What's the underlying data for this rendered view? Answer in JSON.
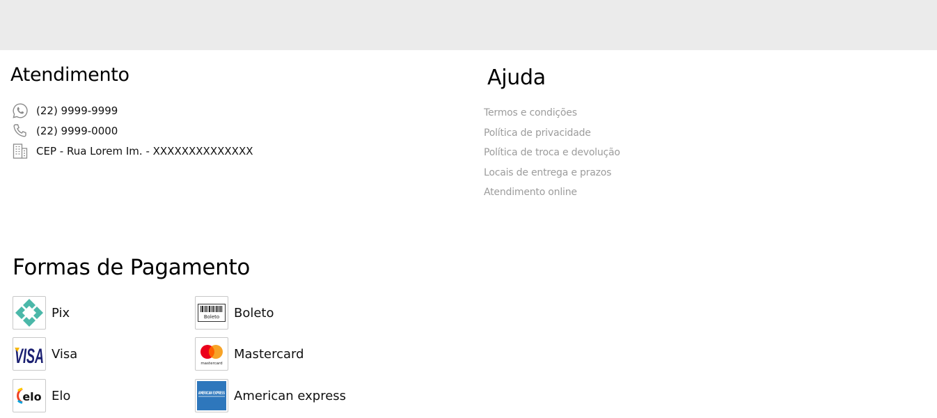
{
  "atendimento": {
    "title": "Atendimento",
    "contacts": [
      {
        "icon": "whatsapp-icon",
        "text": "(22) 9999-9999"
      },
      {
        "icon": "phone-icon",
        "text": "(22) 9999-0000"
      },
      {
        "icon": "building-icon",
        "text": "CEP - Rua Lorem Im. - XXXXXXXXXXXXXX"
      }
    ]
  },
  "ajuda": {
    "title": "Ajuda",
    "links": [
      "Termos e condições",
      "Política de privacidade",
      "Política de troca e devolução",
      "Locais de entrega e prazos",
      "Atendimento online"
    ]
  },
  "pagamento": {
    "title": "Formas de Pagamento",
    "methods": [
      {
        "label": "Pix",
        "logo": "pix-logo"
      },
      {
        "label": "Boleto",
        "logo": "boleto-logo",
        "logo_text": "Boleto"
      },
      {
        "label": "Visa",
        "logo": "visa-logo",
        "logo_text": "VISA"
      },
      {
        "label": "Mastercard",
        "logo": "mastercard-logo",
        "logo_text": "mastercard"
      },
      {
        "label": "Elo",
        "logo": "elo-logo",
        "logo_text": "elo"
      },
      {
        "label": "American express",
        "logo": "amex-logo",
        "logo_text": "AMERICAN EXPRESS"
      }
    ]
  },
  "colors": {
    "top_band": "#ebebeb",
    "help_link": "#9c9c9c",
    "pix": "#4bb8a9",
    "visa_blue": "#1a1f71",
    "visa_gold": "#f7b600",
    "mc_red": "#eb001b",
    "mc_orange": "#f79e1b",
    "amex_blue": "#2e77bc"
  }
}
